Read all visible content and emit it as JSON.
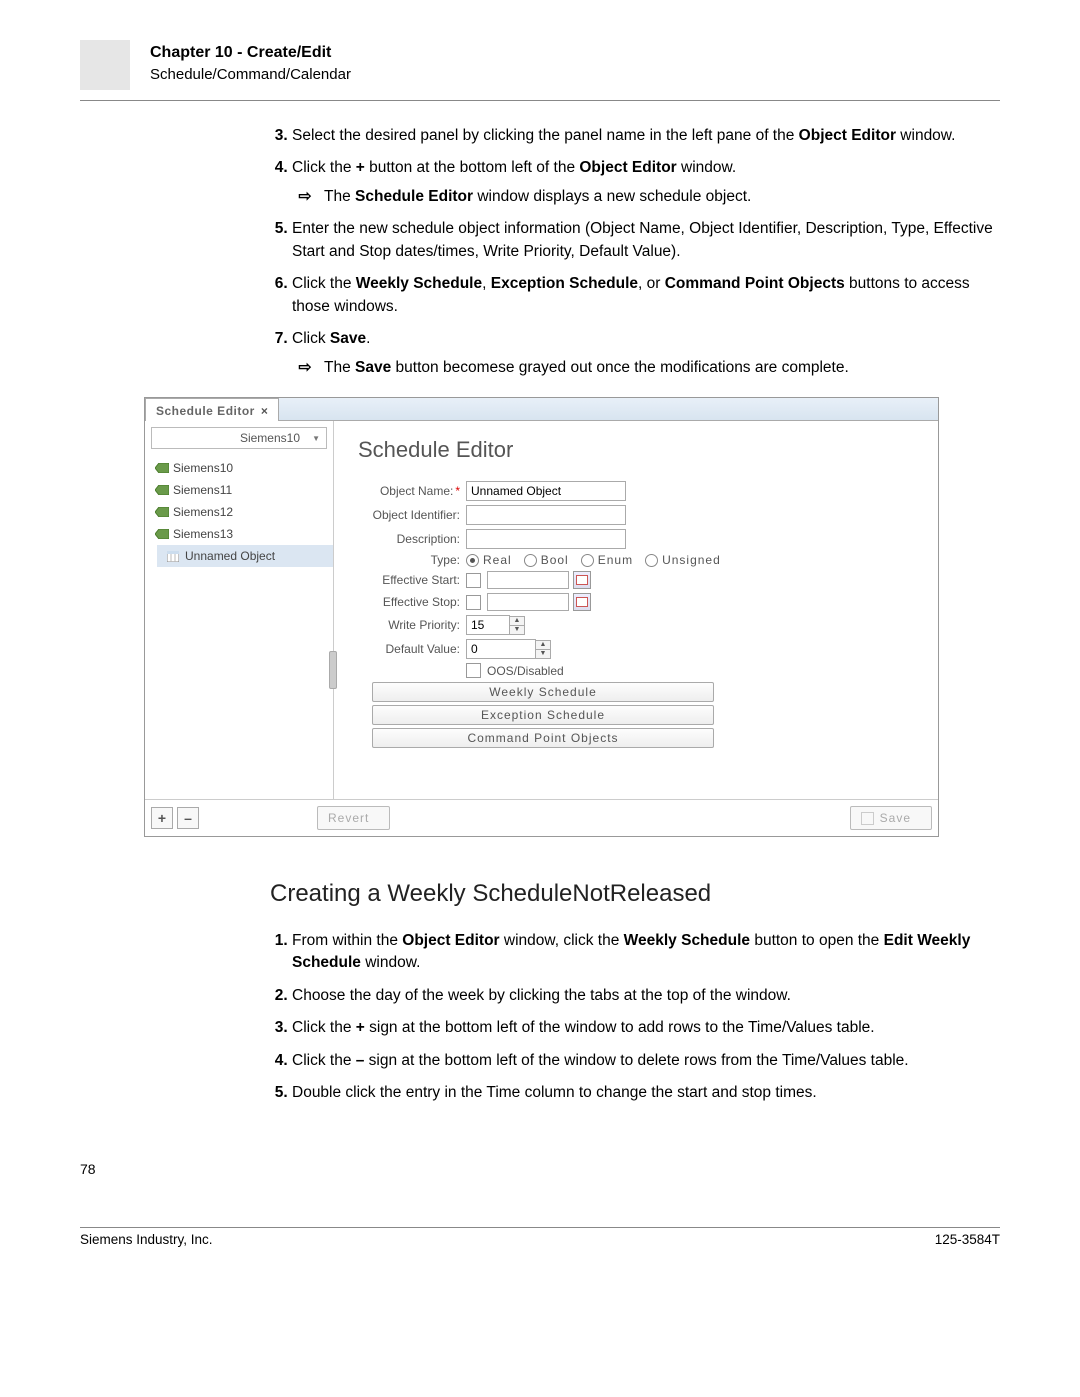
{
  "header": {
    "chapter": "Chapter 10 - Create/Edit",
    "subtitle": "Schedule/Command/Calendar"
  },
  "steps_top": {
    "s3": {
      "pre": "Select the desired panel by clicking the panel name in the left pane of the ",
      "b1": "Object Editor",
      "post": " window."
    },
    "s4": {
      "pre": "Click the ",
      "b1": "+",
      "mid": " button at the bottom left of the ",
      "b2": "Object Editor",
      "post": " window."
    },
    "s4_sub": {
      "pre": "The ",
      "b1": "Schedule Editor",
      "post": " window displays a new schedule object."
    },
    "s5": "Enter the new schedule object information (Object Name, Object Identifier, Description, Type, Effective Start and Stop dates/times, Write Priority, Default Value).",
    "s6": {
      "pre": "Click the ",
      "b1": "Weekly Schedule",
      "c1": ", ",
      "b2": "Exception Schedule",
      "c2": ", or ",
      "b3": "Command Point Objects",
      "post": " buttons to access those windows."
    },
    "s7": {
      "pre": "Click ",
      "b1": "Save",
      "post": "."
    },
    "s7_sub": {
      "pre": "The ",
      "b1": "Save",
      "post": " button becomese grayed out once the modifications are complete."
    }
  },
  "editor": {
    "tab_label": "Schedule Editor",
    "dropdown": "Siemens10",
    "tree": {
      "items": [
        {
          "label": "Siemens10",
          "type": "panel"
        },
        {
          "label": "Siemens11",
          "type": "panel"
        },
        {
          "label": "Siemens12",
          "type": "panel"
        },
        {
          "label": "Siemens13",
          "type": "panel"
        },
        {
          "label": "Unnamed Object",
          "type": "schedule"
        }
      ]
    },
    "main_title": "Schedule Editor",
    "labels": {
      "object_name": "Object Name:",
      "object_identifier": "Object Identifier:",
      "description": "Description:",
      "type": "Type:",
      "effective_start": "Effective Start:",
      "effective_stop": "Effective Stop:",
      "write_priority": "Write Priority:",
      "default_value": "Default Value:",
      "oos": "OOS/Disabled"
    },
    "values": {
      "object_name": "Unnamed Object",
      "write_priority": "15",
      "default_value": "0"
    },
    "type_options": {
      "real": "Real",
      "bool": "Bool",
      "enum": "Enum",
      "unsigned": "Unsigned"
    },
    "buttons": {
      "weekly": "Weekly Schedule",
      "exception": "Exception Schedule",
      "command": "Command Point Objects",
      "revert": "Revert",
      "save": "Save",
      "plus": "+",
      "minus": "–"
    }
  },
  "section2": {
    "heading": "Creating a Weekly ScheduleNotReleased",
    "s1": {
      "pre": "From within the ",
      "b1": "Object Editor",
      "mid": " window, click the ",
      "b2": "Weekly Schedule",
      "mid2": " button to open the ",
      "b3": "Edit Weekly Schedule",
      "post": " window."
    },
    "s2": "Choose the day of the week by clicking the tabs at the top of the window.",
    "s3": {
      "pre": "Click the ",
      "b1": "+",
      "post": " sign at the bottom left of the window to add rows to the Time/Values table."
    },
    "s4": {
      "pre": "Click the ",
      "b1": "–",
      "post": " sign at the bottom left of the window to delete rows from the Time/Values table."
    },
    "s5": "Double click the entry in the Time column to change the start and stop times."
  },
  "footer": {
    "page_num": "78",
    "company": "Siemens Industry, Inc.",
    "docid": "125-3584T"
  },
  "icons": {
    "arrow": "⇨",
    "close": "×",
    "dd": "▼",
    "up": "▲",
    "down": "▼"
  }
}
